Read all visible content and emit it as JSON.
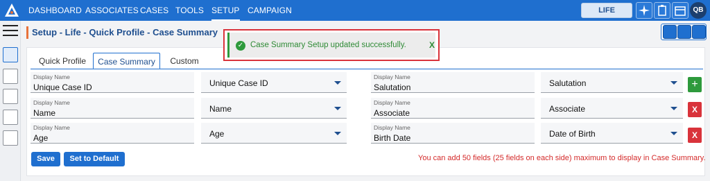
{
  "nav": {
    "items": [
      "DASHBOARD",
      "ASSOCIATES",
      "CASES",
      "TOOLS",
      "SETUP",
      "CAMPAIGN"
    ],
    "active": "SETUP",
    "life_label": "LIFE",
    "avatar_initials": "QB"
  },
  "header": {
    "title": "Setup - Life - Quick Profile - Case Summary"
  },
  "tabs": [
    "Quick Profile",
    "Case Summary",
    "Custom"
  ],
  "fields": {
    "label": "Display Name",
    "left": [
      {
        "display_name": "Unique Case ID",
        "select": "Unique Case ID"
      },
      {
        "display_name": "Name",
        "select": "Name"
      },
      {
        "display_name": "Age",
        "select": "Age"
      }
    ],
    "right": [
      {
        "display_name": "Salutation",
        "select": "Salutation"
      },
      {
        "display_name": "Associate",
        "select": "Associate"
      },
      {
        "display_name": "Birth Date",
        "select": "Date of Birth"
      }
    ]
  },
  "buttons": {
    "add": "+",
    "remove": "X",
    "save": "Save",
    "default": "Set to Default"
  },
  "info_text": "You can add 50 fields (25 fields on each side) maximum to display in Case Summary.",
  "toast": {
    "message": "Case Summary Setup updated successfully.",
    "close": "X",
    "check": "✓"
  },
  "colors": {
    "primary": "#1f6fcf",
    "success": "#2e9a3c",
    "danger": "#d9333b",
    "accent": "#e8723a"
  }
}
